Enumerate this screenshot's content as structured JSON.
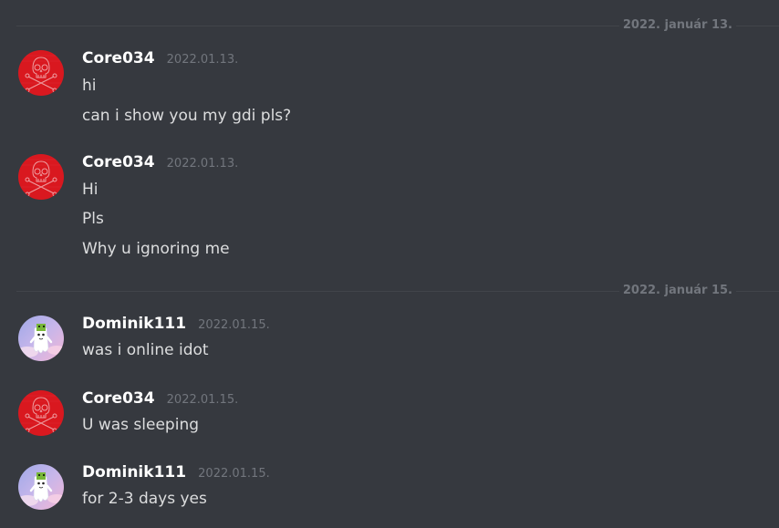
{
  "dividers": [
    {
      "label": "2022. január 13."
    },
    {
      "label": "2022. január 15."
    }
  ],
  "messages": [
    {
      "author": "Core034",
      "time": "2022.01.13.",
      "avatar_icon": "skull-crossbones-icon",
      "lines": [
        "hi",
        "can i show you my gdi pls?"
      ]
    },
    {
      "author": "Core034",
      "time": "2022.01.13.",
      "avatar_icon": "skull-crossbones-icon",
      "lines": [
        "Hi",
        "Pls",
        "Why u ignoring me"
      ]
    },
    {
      "author": "Dominik111",
      "time": "2022.01.15.",
      "avatar_icon": "ghost-character-icon",
      "lines": [
        "was i online idot"
      ]
    },
    {
      "author": "Core034",
      "time": "2022.01.15.",
      "avatar_icon": "skull-crossbones-icon",
      "lines": [
        "U was sleeping"
      ]
    },
    {
      "author": "Dominik111",
      "time": "2022.01.15.",
      "avatar_icon": "ghost-character-icon",
      "lines": [
        "for 2-3 days yes"
      ]
    }
  ],
  "colors": {
    "background": "#36393f",
    "divider": "#42454a",
    "username": "#ffffff",
    "timestamp": "#72767d",
    "message_text": "#dcddde",
    "core_avatar": "#d9181f"
  }
}
